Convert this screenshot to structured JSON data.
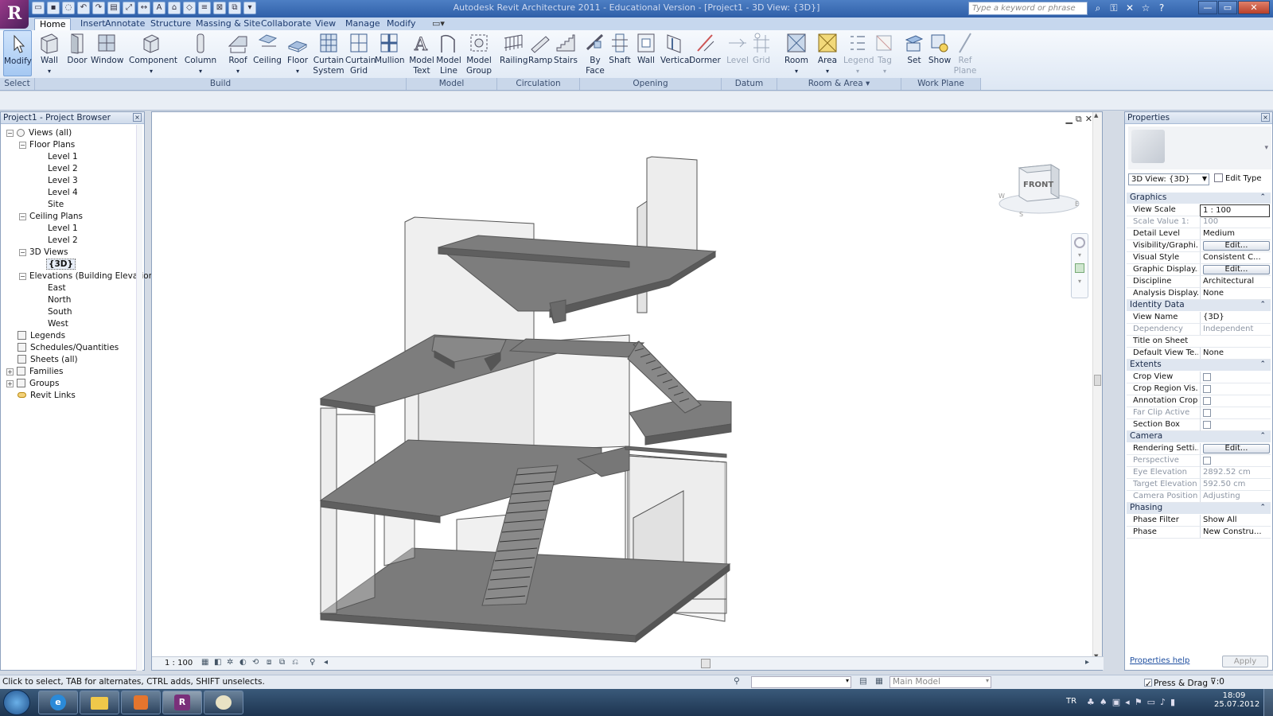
{
  "window": {
    "title": "Autodesk Revit Architecture 2011 - Educational Version - [Project1 - 3D View: {3D}]",
    "search_placeholder": "Type a keyword or phrase"
  },
  "ribbon_tabs": [
    "Home",
    "Insert",
    "Annotate",
    "Structure",
    "Massing & Site",
    "Collaborate",
    "View",
    "Manage",
    "Modify"
  ],
  "ribbon": {
    "buttons": [
      {
        "label": "Modify",
        "icon": "cursor-icon"
      },
      {
        "label": "Wall",
        "icon": "wall-icon"
      },
      {
        "label": "Door",
        "icon": "door-icon"
      },
      {
        "label": "Window",
        "icon": "window-icon"
      },
      {
        "label": "Component",
        "icon": "component-icon"
      },
      {
        "label": "Column",
        "icon": "column-icon"
      },
      {
        "label": "Roof",
        "icon": "roof-icon"
      },
      {
        "label": "Ceiling",
        "icon": "ceiling-icon"
      },
      {
        "label": "Floor",
        "icon": "floor-icon"
      },
      {
        "label": "Curtain System",
        "icon": "curtain-system-icon"
      },
      {
        "label": "Curtain Grid",
        "icon": "curtain-grid-icon"
      },
      {
        "label": "Mullion",
        "icon": "mullion-icon"
      },
      {
        "label": "Model Text",
        "icon": "model-text-icon"
      },
      {
        "label": "Model Line",
        "icon": "model-line-icon"
      },
      {
        "label": "Model Group",
        "icon": "model-group-icon"
      },
      {
        "label": "Railing",
        "icon": "railing-icon"
      },
      {
        "label": "Ramp",
        "icon": "ramp-icon"
      },
      {
        "label": "Stairs",
        "icon": "stairs-icon"
      },
      {
        "label": "By Face",
        "icon": "by-face-icon"
      },
      {
        "label": "Shaft",
        "icon": "shaft-icon"
      },
      {
        "label": "Wall",
        "icon": "wall-opening-icon"
      },
      {
        "label": "Vertical",
        "icon": "vertical-icon"
      },
      {
        "label": "Dormer",
        "icon": "dormer-icon"
      },
      {
        "label": "Level",
        "icon": "level-icon"
      },
      {
        "label": "Grid",
        "icon": "grid-icon"
      },
      {
        "label": "Room",
        "icon": "room-icon"
      },
      {
        "label": "Area",
        "icon": "area-icon"
      },
      {
        "label": "Legend",
        "icon": "legend-icon"
      },
      {
        "label": "Tag",
        "icon": "tag-icon"
      },
      {
        "label": "Set",
        "icon": "set-icon"
      },
      {
        "label": "Show",
        "icon": "show-icon"
      },
      {
        "label": "Ref Plane",
        "icon": "ref-plane-icon"
      }
    ],
    "panels": [
      "Select",
      "Build",
      "Model",
      "Circulation",
      "Opening",
      "Datum",
      "Room & Area ▾",
      "Work Plane"
    ]
  },
  "browser": {
    "title": "Project1 - Project Browser",
    "items": [
      {
        "label": "Views (all)",
        "toggle": "−"
      },
      {
        "label": "Floor Plans",
        "toggle": "−"
      },
      {
        "label": "Level 1"
      },
      {
        "label": "Level 2"
      },
      {
        "label": "Level 3"
      },
      {
        "label": "Level 4"
      },
      {
        "label": "Site"
      },
      {
        "label": "Ceiling Plans",
        "toggle": "−"
      },
      {
        "label": "Level 1"
      },
      {
        "label": "Level 2"
      },
      {
        "label": "3D Views",
        "toggle": "−"
      },
      {
        "label": "{3D}"
      },
      {
        "label": "Elevations (Building Elevation)",
        "toggle": "−"
      },
      {
        "label": "East"
      },
      {
        "label": "North"
      },
      {
        "label": "South"
      },
      {
        "label": "West"
      },
      {
        "label": "Legends"
      },
      {
        "label": "Schedules/Quantities"
      },
      {
        "label": "Sheets (all)"
      },
      {
        "label": "Families",
        "toggle": "+"
      },
      {
        "label": "Groups",
        "toggle": "+"
      },
      {
        "label": "Revit Links"
      }
    ]
  },
  "viewport": {
    "viewcube_face": "FRONT",
    "scale": "1 : 100"
  },
  "properties": {
    "title": "Properties",
    "type_selector": "3D View: {3D}",
    "edit_type": "Edit Type",
    "sections": [
      {
        "name": "Graphics",
        "rows": [
          {
            "name": "View Scale",
            "value": "1 : 100"
          },
          {
            "name": "Scale Value    1:",
            "value": "100",
            "dim": true
          },
          {
            "name": "Detail Level",
            "value": "Medium"
          },
          {
            "name": "Visibility/Graphi...",
            "value": "Edit...",
            "button": true
          },
          {
            "name": "Visual Style",
            "value": "Consistent C..."
          },
          {
            "name": "Graphic Display...",
            "value": "Edit...",
            "button": true
          },
          {
            "name": "Discipline",
            "value": "Architectural"
          },
          {
            "name": "Analysis Display...",
            "value": "None"
          }
        ]
      },
      {
        "name": "Identity Data",
        "rows": [
          {
            "name": "View Name",
            "value": "{3D}"
          },
          {
            "name": "Dependency",
            "value": "Independent",
            "dim": true
          },
          {
            "name": "Title on Sheet",
            "value": ""
          },
          {
            "name": "Default View Te...",
            "value": "None"
          }
        ]
      },
      {
        "name": "Extents",
        "rows": [
          {
            "name": "Crop View",
            "value": "",
            "check": true
          },
          {
            "name": "Crop Region Vis...",
            "value": "",
            "check": true
          },
          {
            "name": "Annotation Crop",
            "value": "",
            "check": true
          },
          {
            "name": "Far Clip Active",
            "value": "",
            "check": true,
            "dim": true
          },
          {
            "name": "Section Box",
            "value": "",
            "check": true
          }
        ]
      },
      {
        "name": "Camera",
        "rows": [
          {
            "name": "Rendering Setti...",
            "value": "Edit...",
            "button": true
          },
          {
            "name": "Perspective",
            "value": "",
            "check": true,
            "dim": true
          },
          {
            "name": "Eye Elevation",
            "value": "2892.52 cm",
            "dim": true
          },
          {
            "name": "Target Elevation",
            "value": "592.50 cm",
            "dim": true
          },
          {
            "name": "Camera Position",
            "value": "Adjusting",
            "dim": true
          }
        ]
      },
      {
        "name": "Phasing",
        "rows": [
          {
            "name": "Phase Filter",
            "value": "Show All"
          },
          {
            "name": "Phase",
            "value": "New Constru..."
          }
        ]
      }
    ],
    "help_link": "Properties help",
    "apply": "Apply"
  },
  "statusbar": {
    "message": "Click to select, TAB for alternates, CTRL adds, SHIFT unselects.",
    "model": "Main Model",
    "press_drag": "Press & Drag",
    "filter_count": ":0"
  },
  "taskbar": {
    "lang": "TR",
    "time": "18:09",
    "date": "25.07.2012"
  }
}
